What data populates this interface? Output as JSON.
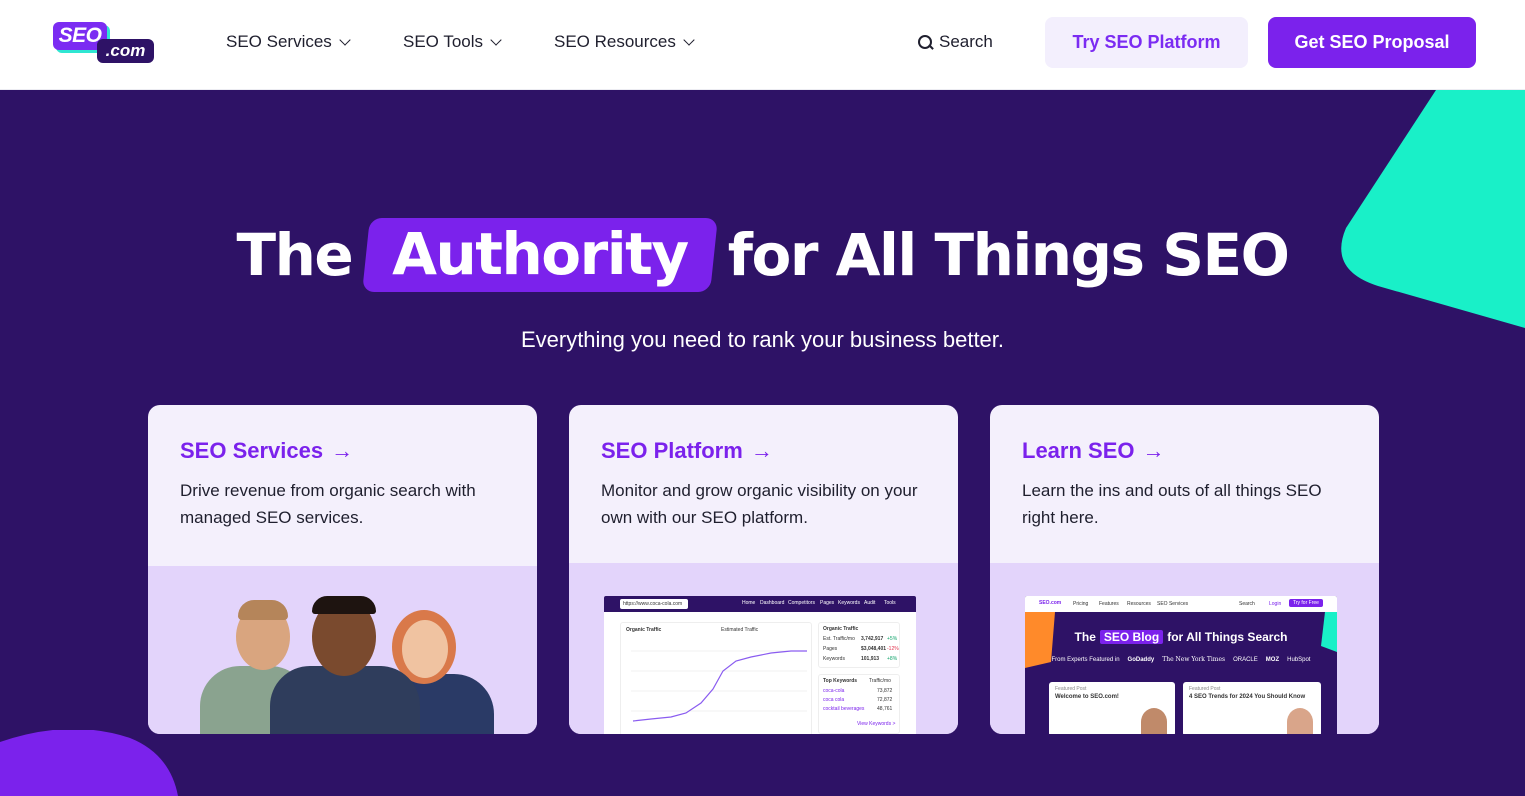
{
  "header": {
    "logo": {
      "primary": "SEO",
      "secondary": ".com"
    },
    "nav": [
      {
        "label": "SEO Services"
      },
      {
        "label": "SEO Tools"
      },
      {
        "label": "SEO Resources"
      }
    ],
    "search_label": "Search",
    "try_button": "Try SEO Platform",
    "proposal_button": "Get SEO Proposal"
  },
  "hero": {
    "title_before": "The",
    "title_highlight": "Authority",
    "title_after": "for All Things SEO",
    "subtitle": "Everything you need to rank your business better."
  },
  "cards": [
    {
      "title": "SEO Services",
      "arrow": "→",
      "description": "Drive revenue from organic search with managed SEO services."
    },
    {
      "title": "SEO Platform",
      "arrow": "→",
      "description": "Monitor and grow organic visibility on your own with our SEO platform."
    },
    {
      "title": "Learn SEO",
      "arrow": "→",
      "description": "Learn the ins and outs of all things SEO right here."
    }
  ],
  "platform_preview": {
    "url": "https://www.coca-cola.com",
    "nav": [
      "Home",
      "Dashboard",
      "Competitors",
      "Pages",
      "Keywords",
      "Audit",
      "Tools"
    ],
    "chart_title": "Organic Traffic",
    "chart_legend": "Estimated Traffic",
    "side_title": "Organic Traffic",
    "rows": [
      {
        "label": "Est. Traffic/mo",
        "value": "3,742,917",
        "change": "+5%"
      },
      {
        "label": "Pages",
        "value": "$3,048,401",
        "change": "-12%"
      },
      {
        "label": "Keywords",
        "value": "101,913",
        "change": "+8%"
      }
    ],
    "keywords_title": "Top Keywords",
    "keywords_col": "Traffic/mo",
    "keywords": [
      {
        "kw": "coca-cola",
        "val": "73,872"
      },
      {
        "kw": "coca cola",
        "val": "72,872"
      },
      {
        "kw": "cocktail beverages",
        "val": "48,761"
      }
    ],
    "view_link": "View Keywords >"
  },
  "blog_preview": {
    "logo": "SEO.com",
    "nav": [
      "Pricing",
      "Features",
      "Resources",
      "SEO Services"
    ],
    "search": "Search",
    "login": "Login",
    "try": "Try for Free",
    "title_before": "The",
    "title_highlight": "SEO Blog",
    "title_after": "for All Things Search",
    "featured_in": "From Experts Featured in",
    "brands": [
      "GoDaddy",
      "The New York Times",
      "ORACLE",
      "MOZ",
      "HubSpot"
    ],
    "post1_tag": "Featured Post",
    "post1_title": "Welcome to SEO.com!",
    "post2_tag": "Featured Post",
    "post2_title": "4 SEO Trends for 2024 You Should Know"
  }
}
